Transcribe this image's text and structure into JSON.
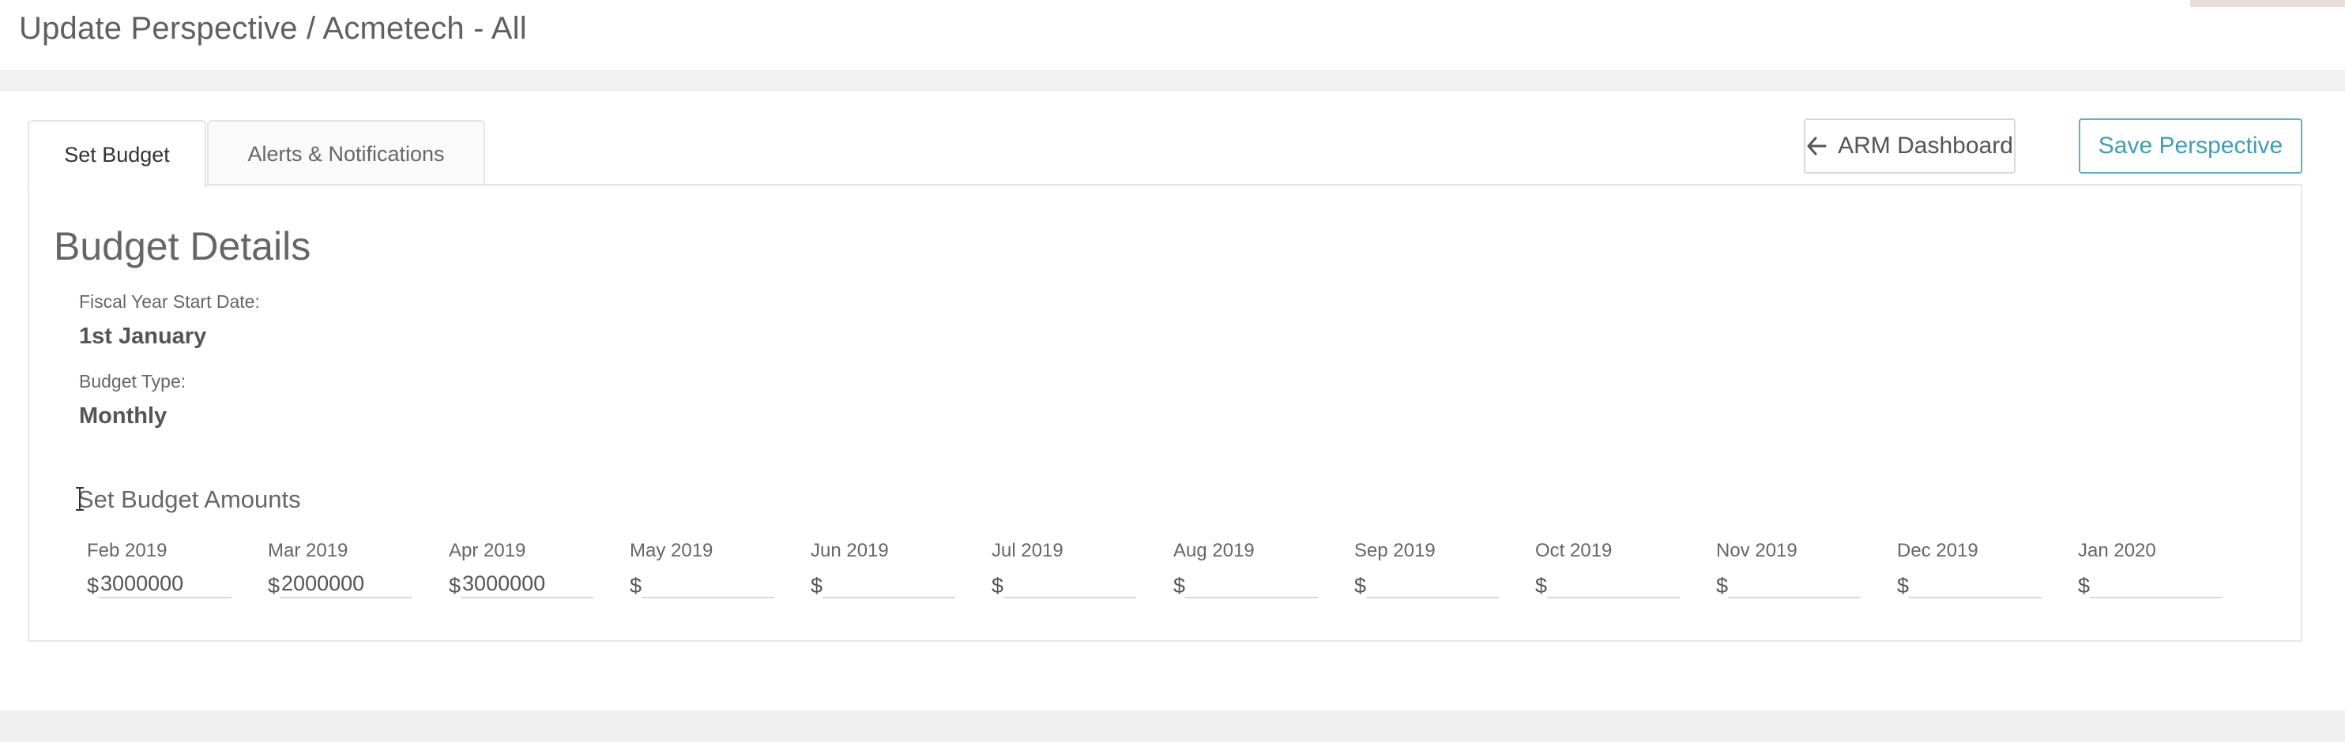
{
  "header": {
    "title": "Update Perspective / Acmetech - All"
  },
  "tabs": [
    {
      "label": "Set Budget",
      "active": true
    },
    {
      "label": "Alerts & Notifications",
      "active": false
    }
  ],
  "actions": {
    "arm_dashboard": "ARM Dashboard",
    "save_perspective": "Save Perspective"
  },
  "budget": {
    "section_title": "Budget Details",
    "fiscal_year_label": "Fiscal Year Start Date:",
    "fiscal_year_value": "1st January",
    "budget_type_label": "Budget Type:",
    "budget_type_value": "Monthly",
    "amounts_title": "Set Budget Amounts",
    "currency_symbol": "$",
    "months": [
      {
        "label": "Feb 2019",
        "value": "3000000"
      },
      {
        "label": "Mar 2019",
        "value": "2000000"
      },
      {
        "label": "Apr 2019",
        "value": "3000000"
      },
      {
        "label": "May 2019",
        "value": ""
      },
      {
        "label": "Jun 2019",
        "value": ""
      },
      {
        "label": "Jul 2019",
        "value": ""
      },
      {
        "label": "Aug 2019",
        "value": ""
      },
      {
        "label": "Sep 2019",
        "value": ""
      },
      {
        "label": "Oct 2019",
        "value": ""
      },
      {
        "label": "Nov 2019",
        "value": ""
      },
      {
        "label": "Dec 2019",
        "value": ""
      },
      {
        "label": "Jan 2020",
        "value": ""
      }
    ]
  },
  "colors": {
    "accent": "#3f9fb3",
    "border": "#e4e4e4",
    "text": "#555555"
  },
  "icons": {
    "back": "arrow-left-icon",
    "cursor": "text-cursor-icon"
  }
}
